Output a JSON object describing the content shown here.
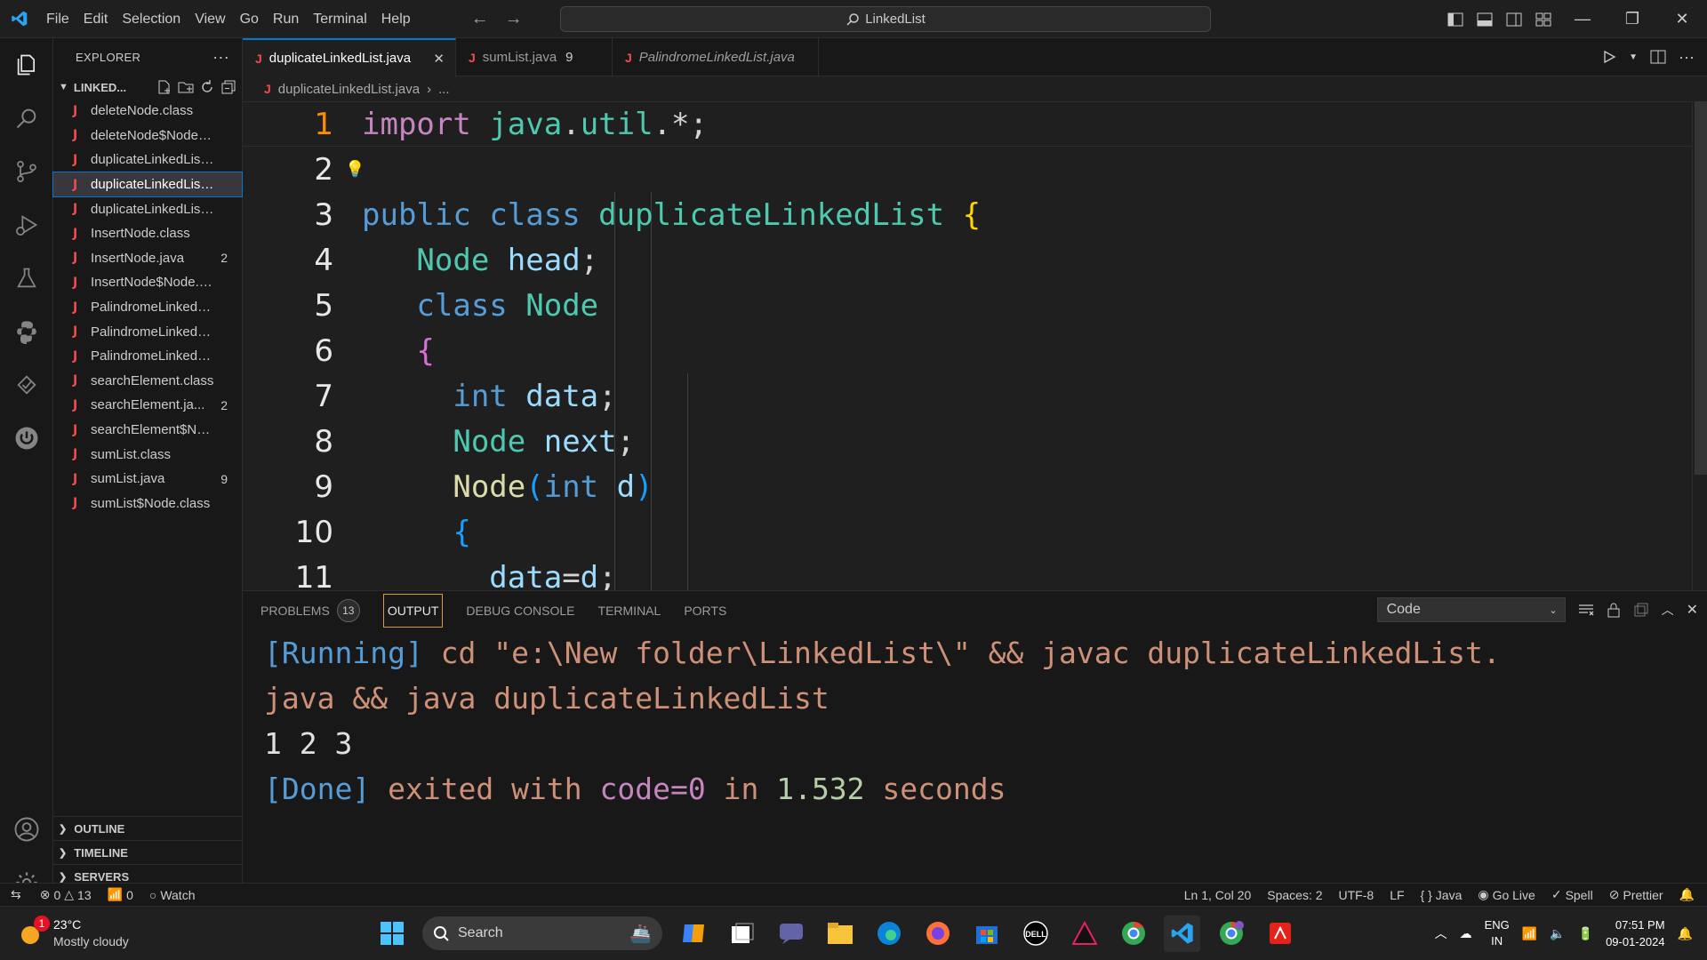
{
  "titlebar": {
    "menu": [
      "File",
      "Edit",
      "Selection",
      "View",
      "Go",
      "Run",
      "Terminal",
      "Help"
    ],
    "search_text": "LinkedList"
  },
  "explorer": {
    "title": "EXPLORER",
    "folder": "LINKED...",
    "files": [
      {
        "name": "deleteNode.class",
        "badge": ""
      },
      {
        "name": "deleteNode$Node.cla...",
        "badge": ""
      },
      {
        "name": "duplicateLinkedList.cl...",
        "badge": ""
      },
      {
        "name": "duplicateLinkedList.java",
        "badge": "",
        "active": true
      },
      {
        "name": "duplicateLinkedList$...",
        "badge": ""
      },
      {
        "name": "InsertNode.class",
        "badge": ""
      },
      {
        "name": "InsertNode.java",
        "badge": "2"
      },
      {
        "name": "InsertNode$Node.class",
        "badge": ""
      },
      {
        "name": "PalindromeLinkedList....",
        "badge": ""
      },
      {
        "name": "PalindromeLinkedList....",
        "badge": ""
      },
      {
        "name": "PalindromeLinkedList...",
        "badge": ""
      },
      {
        "name": "searchElement.class",
        "badge": ""
      },
      {
        "name": "searchElement.ja...",
        "badge": "2"
      },
      {
        "name": "searchElement$Node....",
        "badge": ""
      },
      {
        "name": "sumList.class",
        "badge": ""
      },
      {
        "name": "sumList.java",
        "badge": "9"
      },
      {
        "name": "sumList$Node.class",
        "badge": ""
      }
    ],
    "sections": [
      "OUTLINE",
      "TIMELINE",
      "SERVERS"
    ]
  },
  "tabs": [
    {
      "label": "duplicateLinkedList.java",
      "count": "",
      "active": true
    },
    {
      "label": "sumList.java",
      "count": "9"
    },
    {
      "label": "PalindromeLinkedList.java",
      "count": "",
      "italic": true
    }
  ],
  "breadcrumbs": {
    "file": "duplicateLinkedList.java",
    "more": "..."
  },
  "editor": {
    "line_numbers": [
      "1",
      "2",
      "3",
      "4",
      "5",
      "6",
      "7",
      "8",
      "9",
      "10",
      "11"
    ],
    "lines": [
      "import java.util.*;",
      "",
      "public class duplicateLinkedList {",
      "Node head;",
      "class Node",
      "{",
      "int data;",
      "Node next;",
      "Node(int d)",
      "{",
      "data=d;"
    ]
  },
  "panel": {
    "tabs": [
      "PROBLEMS",
      "OUTPUT",
      "DEBUG CONSOLE",
      "TERMINAL",
      "PORTS"
    ],
    "problems_count": "13",
    "select_value": "Code",
    "output": {
      "run_tag": "[Running]",
      "cmd_line1": " cd \"e:\\New folder\\LinkedList\\\" && javac duplicateLinkedList.",
      "cmd_line2": "java && java duplicateLinkedList",
      "result": "1 2 3",
      "done_tag": "[Done]",
      "exited": " exited with ",
      "code": "code=0",
      "in": " in ",
      "seconds_num": "1.532",
      "seconds": " seconds"
    }
  },
  "statusbar": {
    "errors": "0",
    "warnings": "13",
    "ports": "0",
    "watch": "Watch",
    "position": "Ln 1, Col 20",
    "spaces": "Spaces: 2",
    "encoding": "UTF-8",
    "eol": "LF",
    "language": "Java",
    "golive": "Go Live",
    "spell": "Spell",
    "prettier": "Prettier"
  },
  "taskbar": {
    "weather_badge": "1",
    "temperature": "23°C",
    "condition": "Mostly cloudy",
    "search_placeholder": "Search",
    "lang_line1": "ENG",
    "lang_line2": "IN",
    "time": "07:51 PM",
    "date": "09-01-2024"
  },
  "colors": {
    "accent": "#0078d4",
    "java_icon": "#f14c4c",
    "current_line_number": "#ff8c00"
  }
}
